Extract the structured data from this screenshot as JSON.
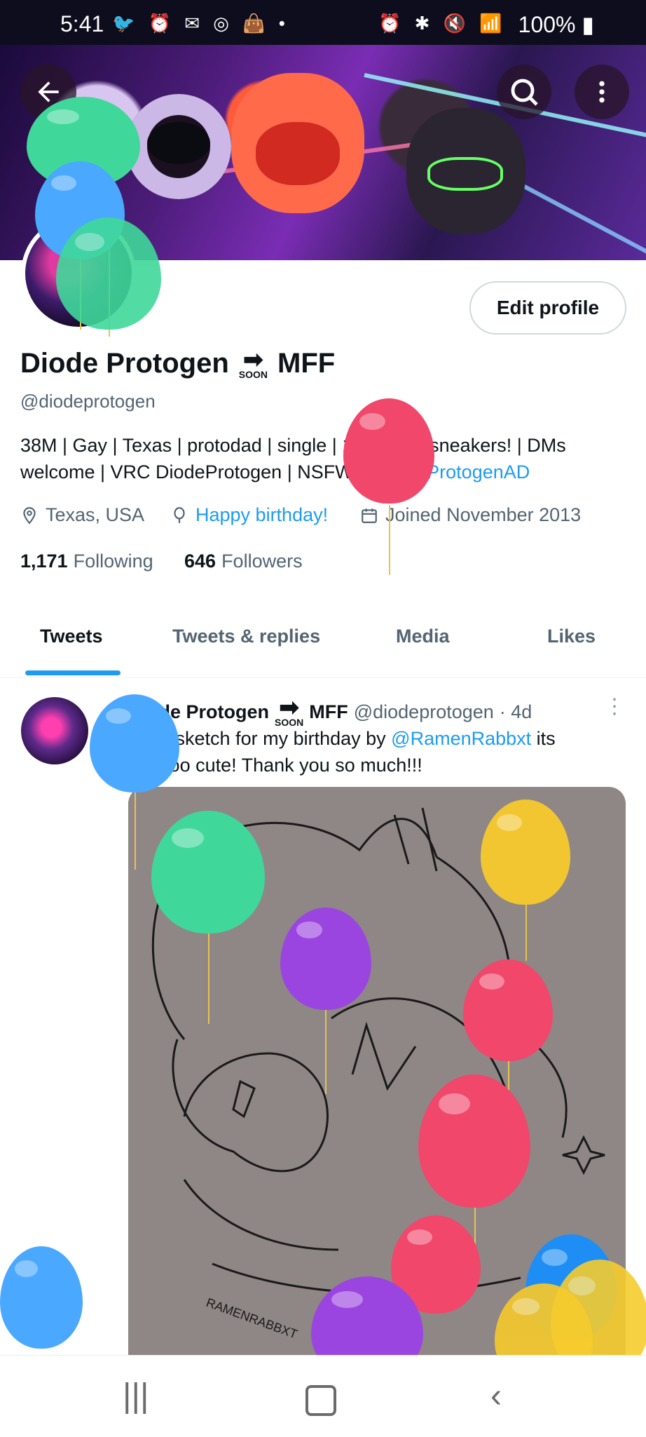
{
  "status_bar": {
    "time": "5:41",
    "left_icons": [
      "twitter-icon",
      "alarm-icon",
      "outlook-icon",
      "instagram-icon",
      "shopping-bag-icon",
      "dot-icon"
    ],
    "right_icons": [
      "alarm-icon",
      "bluetooth-icon",
      "mute-icon",
      "wifi-icon",
      "signal-icon"
    ],
    "battery": "100%"
  },
  "header": {
    "back_icon": "arrow-left-icon",
    "search_icon": "search-icon",
    "more_icon": "more-vertical-icon"
  },
  "profile": {
    "edit_label": "Edit profile",
    "name_first": "Diode Protogen",
    "soon_label": "SOON",
    "name_last": "MFF",
    "handle": "@diodeprotogen",
    "bio_text_1": "38M | Gay | Texas | protodad | single | 18+ only | sneakers! | DMs welcome | VRC DiodeProtogen | NSFW ",
    "bio_link": "@DiodeProtogenAD",
    "location": "Texas, USA",
    "birthday": "Happy birthday!",
    "joined": "Joined November 2013",
    "following_count": "1,171",
    "following_label": "Following",
    "followers_count": "646",
    "followers_label": "Followers"
  },
  "tabs": [
    {
      "label": "Tweets",
      "active": true
    },
    {
      "label": "Tweets & replies",
      "active": false
    },
    {
      "label": "Media",
      "active": false
    },
    {
      "label": "Likes",
      "active": false
    }
  ],
  "tweet": {
    "author_name": "Diode Protogen",
    "soon_label": "SOON",
    "author_suffix": "MFF",
    "author_handle": "@diodeprotogen",
    "time": "· 4d",
    "text_1": "A gift sketch for my birthday by ",
    "text_link": "@RamenRabbxt",
    "text_2": " its sooooo cute! Thank you so much!!!",
    "media_signature": "RAMENRABBXT"
  },
  "colors": {
    "accent": "#1d9bf0",
    "balloon_green": "#3fd89a",
    "balloon_blue": "#4aa8ff",
    "balloon_red": "#f0476b",
    "balloon_purple": "#9b45e0",
    "balloon_yellow": "#f2c631"
  },
  "nav": [
    "recents-icon",
    "home-icon",
    "back-icon"
  ]
}
